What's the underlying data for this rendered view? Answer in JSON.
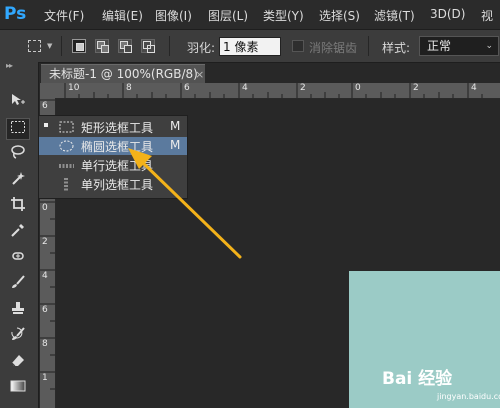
{
  "app": {
    "logo": "Ps",
    "accent": "#31a8ff"
  },
  "menu": [
    "文件(F)",
    "编辑(E)",
    "图像(I)",
    "图层(L)",
    "类型(Y)",
    "选择(S)",
    "滤镜(T)",
    "3D(D)",
    "视"
  ],
  "options_bar": {
    "feather_label": "羽化:",
    "feather_value": "1 像素",
    "antialias_label": "消除锯齿",
    "style_label": "样式:",
    "style_value": "正常"
  },
  "document_tab": {
    "title": "未标题-1 @ 100%(RGB/8) *",
    "close": "×"
  },
  "ruler": {
    "h_labels": [
      "10",
      "8",
      "6",
      "4",
      "2",
      "0",
      "2",
      "4"
    ],
    "v_labels": [
      "6",
      "4",
      "2",
      "0",
      "2",
      "4",
      "6",
      "8",
      "1"
    ]
  },
  "tool_flyout": {
    "items": [
      {
        "label": "矩形选框工具",
        "shortcut": "M",
        "selected": true,
        "highlighted": false,
        "icon": "rect-marquee-icon"
      },
      {
        "label": "椭圆选框工具",
        "shortcut": "M",
        "selected": false,
        "highlighted": true,
        "icon": "ellipse-marquee-icon"
      },
      {
        "label": "单行选框工具",
        "shortcut": "",
        "selected": false,
        "highlighted": false,
        "icon": "single-row-marquee-icon"
      },
      {
        "label": "单列选框工具",
        "shortcut": "",
        "selected": false,
        "highlighted": false,
        "icon": "single-column-marquee-icon"
      }
    ]
  },
  "tools": [
    "move-tool-icon",
    "marquee-tool-icon",
    "lasso-tool-icon",
    "magic-wand-icon",
    "crop-tool-icon",
    "eyedropper-icon",
    "healing-brush-icon",
    "brush-tool-icon",
    "clone-stamp-icon",
    "history-brush-icon",
    "eraser-icon",
    "gradient-icon"
  ],
  "watermark": {
    "text": "Bai 经验",
    "sub": "jingyan.baidu.com"
  },
  "colors": {
    "canvas": "#9bcbc6",
    "highlight": "#5b7a9e",
    "arrow": "#f3b21a"
  }
}
